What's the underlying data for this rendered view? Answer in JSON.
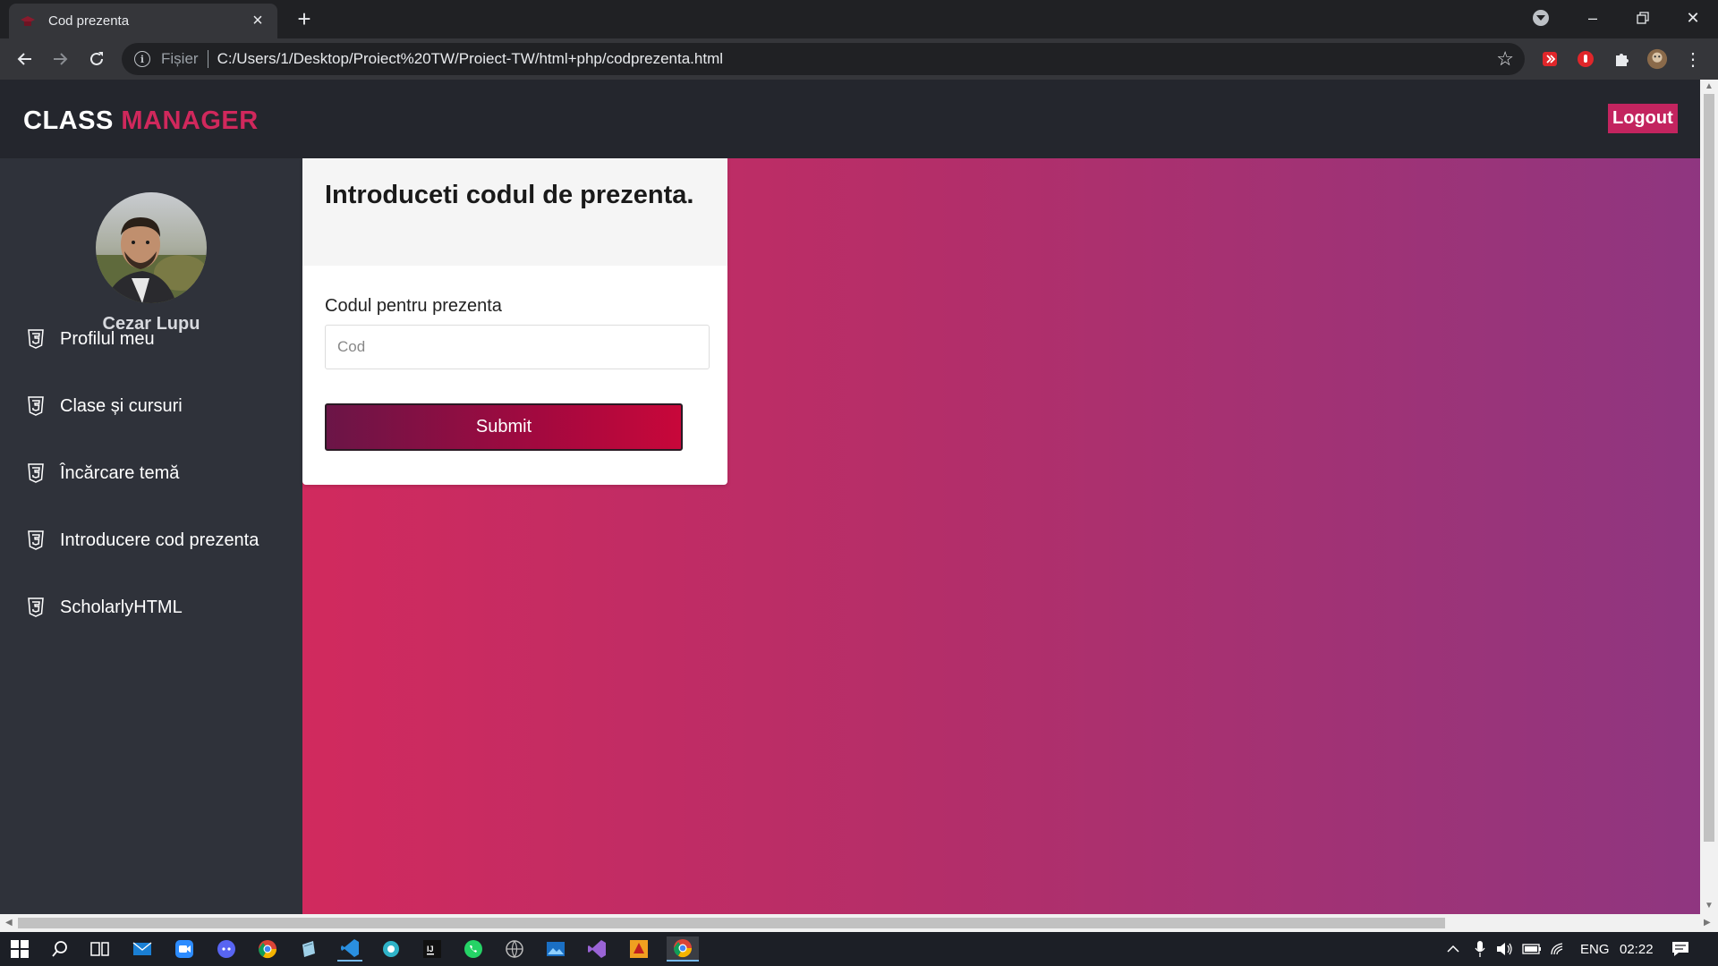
{
  "browser": {
    "tab_title": "Cod prezenta",
    "url_scheme": "Fișier",
    "url": "C:/Users/1/Desktop/Proiect%20TW/Proiect-TW/html+php/codprezenta.html"
  },
  "header": {
    "brand_part1": "CLASS",
    "brand_part2": "MANAGER",
    "logout_label": "Logout"
  },
  "sidebar": {
    "username": "Cezar Lupu",
    "items": [
      {
        "label": "Profilul meu",
        "icon": "html5-icon"
      },
      {
        "label": "Clase și cursuri",
        "icon": "html5-icon"
      },
      {
        "label": "Încărcare temă",
        "icon": "html5-icon"
      },
      {
        "label": "Introducere cod prezenta",
        "icon": "html5-icon"
      },
      {
        "label": "ScholarlyHTML",
        "icon": "html5-icon"
      }
    ]
  },
  "form": {
    "title": "Introduceti codul de prezenta.",
    "field_label": "Codul pentru prezenta",
    "input_placeholder": "Cod",
    "input_value": "",
    "submit_label": "Submit"
  },
  "taskbar": {
    "language": "ENG",
    "time": "02:22"
  },
  "colors": {
    "brand_accent": "#d0285c",
    "logout_bg": "#c3245f",
    "gradient_start": "#d12a5e",
    "gradient_end": "#8f3680",
    "sidebar_bg": "#2f323a",
    "header_bg": "#24262d"
  }
}
